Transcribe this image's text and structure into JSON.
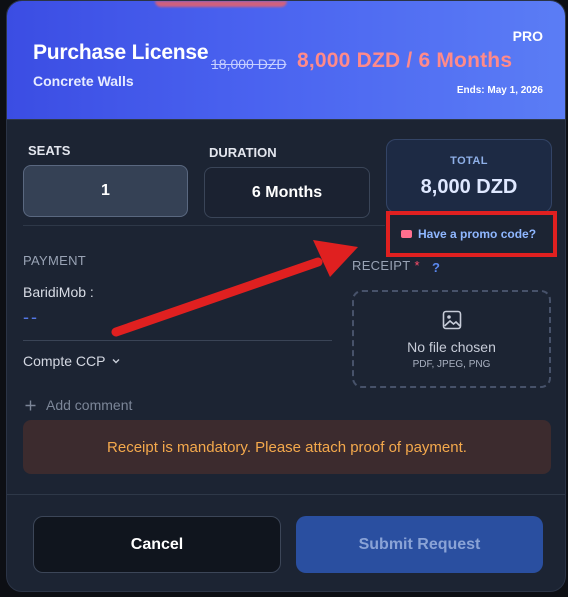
{
  "header": {
    "title": "Purchase License",
    "subtitle": "Concrete Walls",
    "badge": "PRO",
    "old_price": "18,000 DZD",
    "price": "8,000 DZD / 6 Months",
    "ends": "Ends: May 1, 2026"
  },
  "seats": {
    "label": "SEATS",
    "value": "1"
  },
  "duration": {
    "label": "DURATION",
    "value": "6 Months"
  },
  "total": {
    "label": "TOTAL",
    "value": "8,000 DZD"
  },
  "promo": {
    "label": "Have a promo code?"
  },
  "payment": {
    "label": "PAYMENT",
    "method": "BaridiMob :",
    "number": "--",
    "account": "Compte CCP",
    "add_comment": "Add comment"
  },
  "receipt": {
    "label": "RECEIPT",
    "required_mark": "*",
    "help": "?",
    "dropzone_text": "No file chosen",
    "dropzone_hint": "PDF, JPEG, PNG"
  },
  "alert": {
    "message": "Receipt is mandatory. Please attach proof of payment."
  },
  "actions": {
    "cancel": "Cancel",
    "submit": "Submit Request"
  },
  "colors": {
    "accent": "#4a63f0",
    "price": "#ff8a8a",
    "warning": "#f4a94c",
    "annotation": "#e02020"
  },
  "icons": [
    "ticket-icon",
    "chevron-down-icon",
    "plus-icon",
    "image-icon",
    "red-arrow-annotation"
  ]
}
